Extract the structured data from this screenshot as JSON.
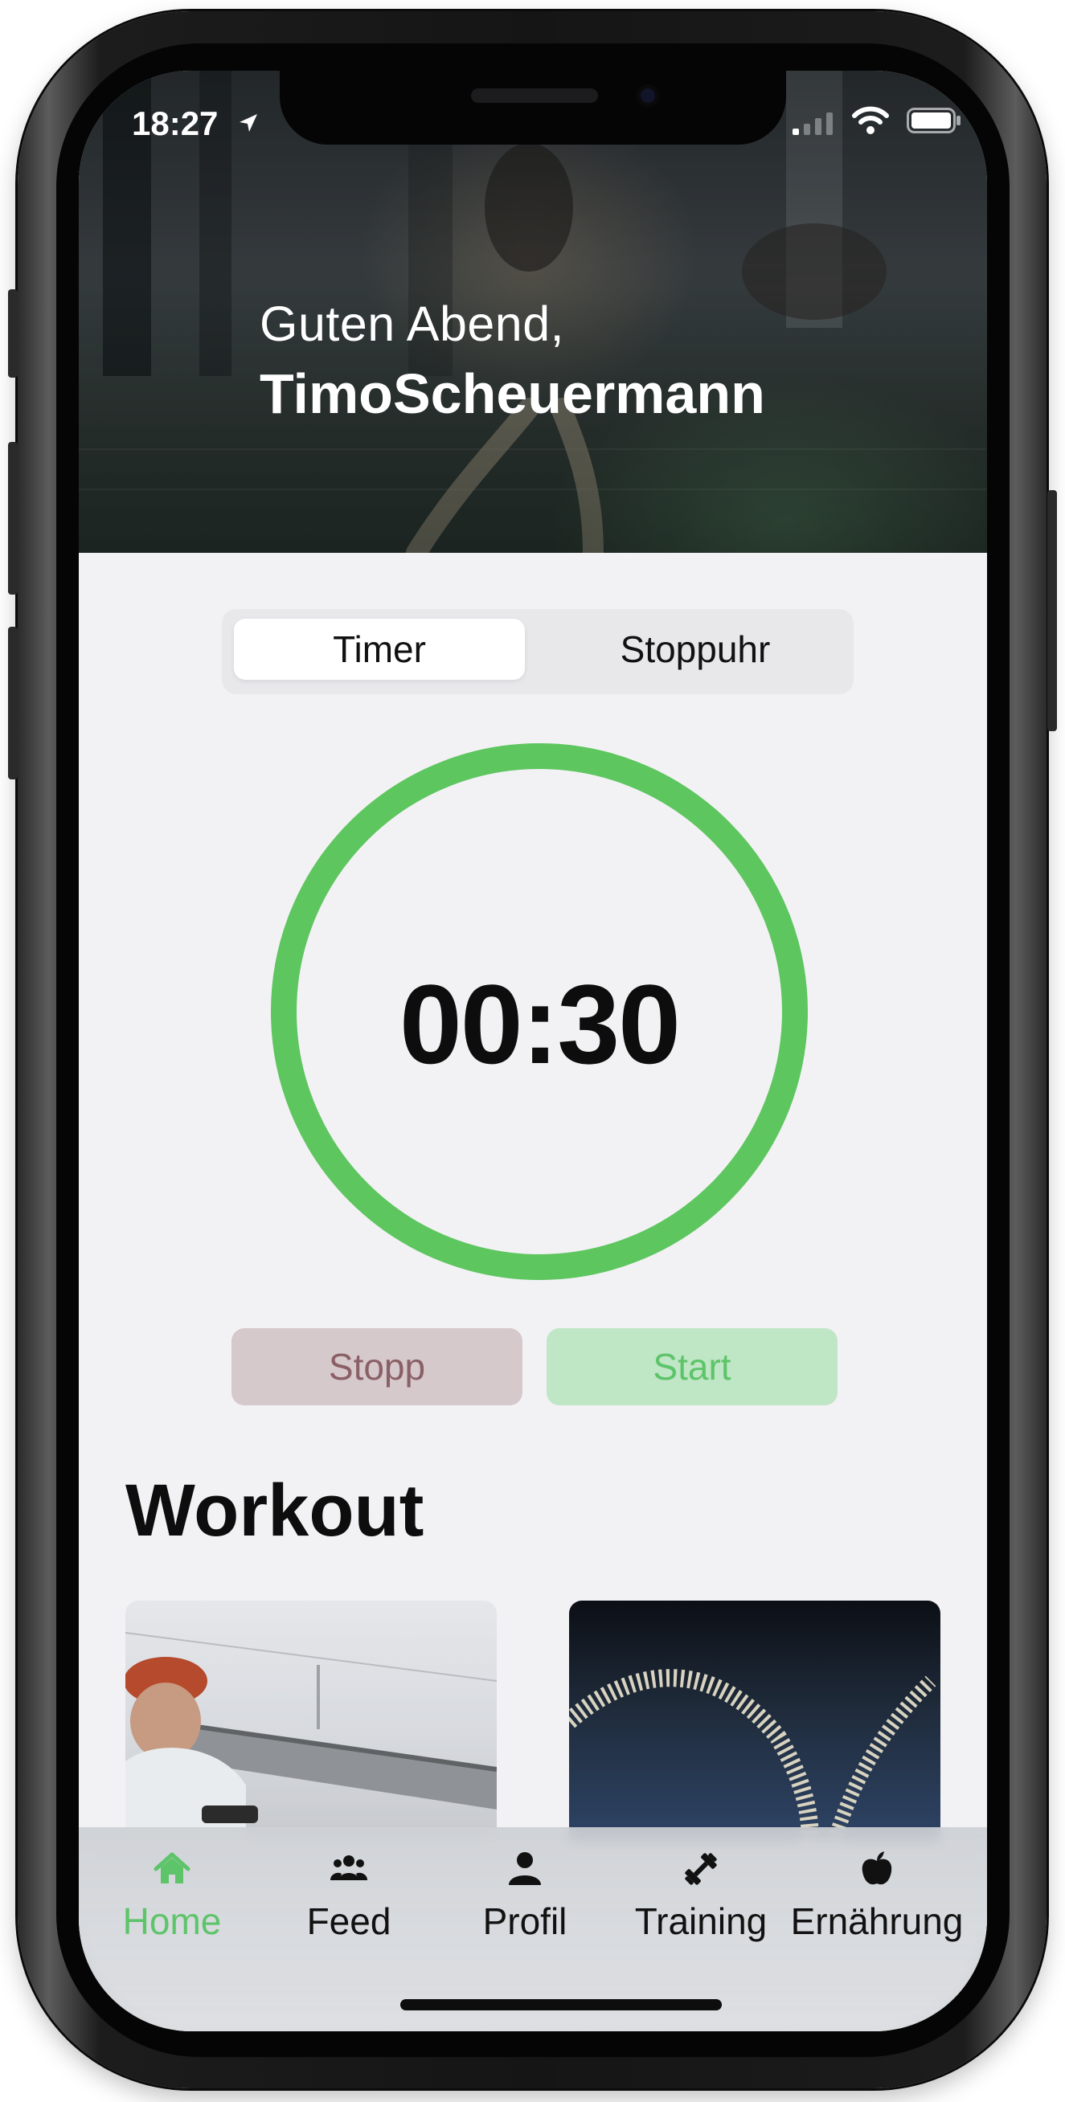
{
  "status_bar": {
    "time": "18:27"
  },
  "header": {
    "greeting": "Guten Abend,",
    "username": "TimoScheuermann"
  },
  "segmented_control": {
    "options": [
      "Timer",
      "Stoppuhr"
    ],
    "selected": "Timer"
  },
  "timer": {
    "display": "00:30",
    "progress": 1.0,
    "ring_color": "#5ec65e"
  },
  "controls": {
    "stop_label": "Stopp",
    "start_label": "Start"
  },
  "workout": {
    "title": "Workout",
    "cards": [
      {
        "image": "man-with-smartwatch-by-bridge-photo"
      },
      {
        "image": "battle-ropes-photo"
      }
    ]
  },
  "tab_bar": {
    "items": [
      {
        "label": "Home",
        "icon": "home-icon",
        "active": true
      },
      {
        "label": "Feed",
        "icon": "people-icon",
        "active": false
      },
      {
        "label": "Profil",
        "icon": "person-icon",
        "active": false
      },
      {
        "label": "Training",
        "icon": "dumbbell-icon",
        "active": false
      },
      {
        "label": "Ernährung",
        "icon": "apple-icon",
        "active": false
      }
    ],
    "active_color": "#5ec46a"
  },
  "colors": {
    "accent_green": "#5ec46a",
    "background": "#f2f2f5"
  }
}
